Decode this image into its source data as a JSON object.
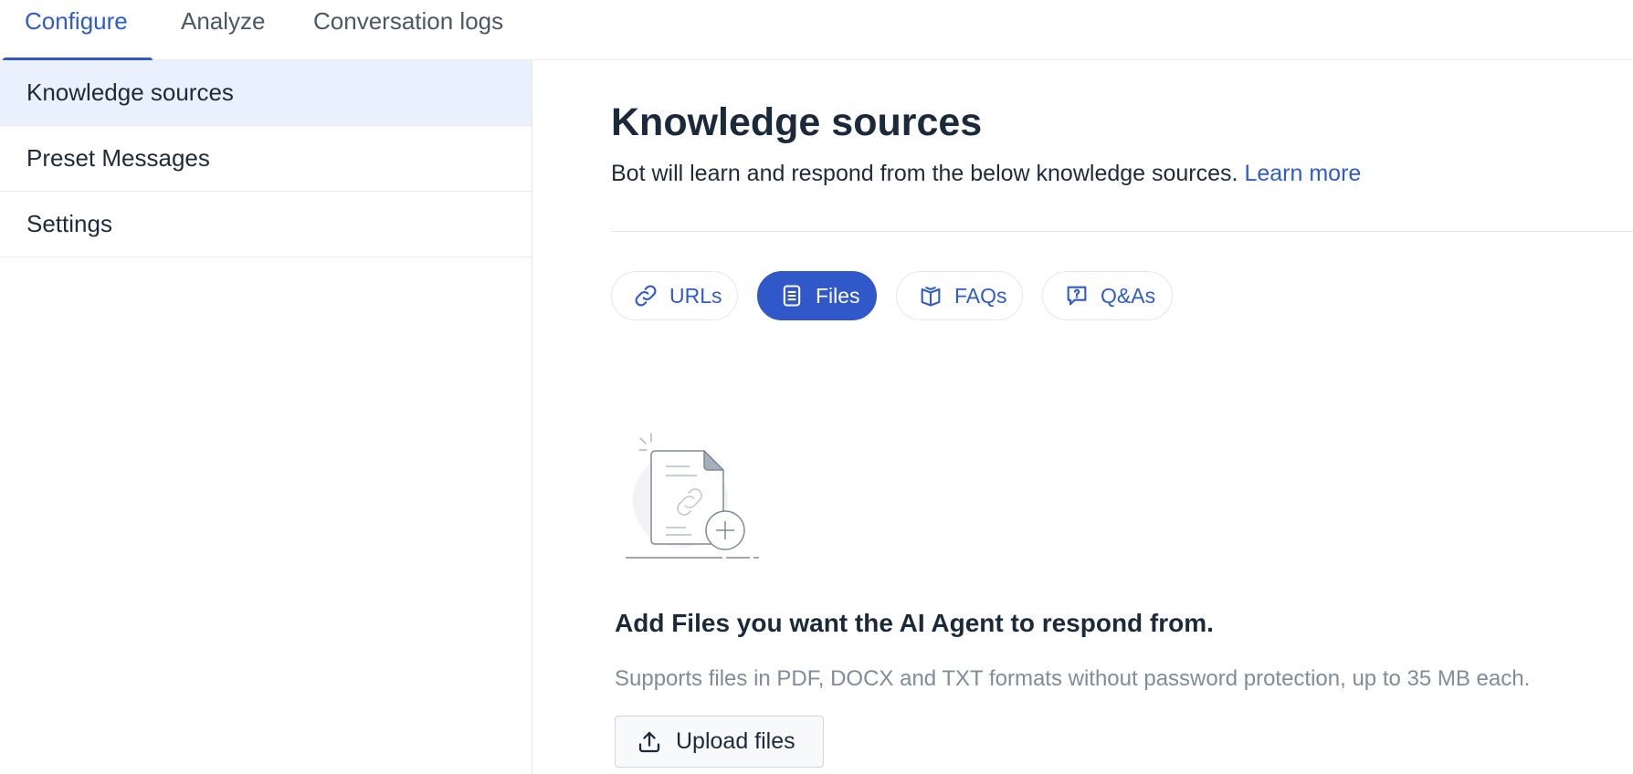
{
  "tabs": [
    {
      "label": "Configure",
      "active": true
    },
    {
      "label": "Analyze",
      "active": false
    },
    {
      "label": "Conversation logs",
      "active": false
    }
  ],
  "sidebar": {
    "items": [
      {
        "label": "Knowledge sources",
        "active": true
      },
      {
        "label": "Preset Messages",
        "active": false
      },
      {
        "label": "Settings",
        "active": false
      }
    ]
  },
  "main": {
    "title": "Knowledge sources",
    "subtitle": "Bot will learn and respond from the below knowledge sources.",
    "learn_more": "Learn more",
    "source_tabs": [
      {
        "label": "URLs",
        "icon": "link-icon",
        "active": false
      },
      {
        "label": "Files",
        "icon": "file-icon",
        "active": true
      },
      {
        "label": "FAQs",
        "icon": "book-icon",
        "active": false
      },
      {
        "label": "Q&As",
        "icon": "chat-question-icon",
        "active": false
      }
    ],
    "empty_state": {
      "illustration": "add-file-illustration",
      "heading": "Add Files you want the AI Agent to respond from.",
      "description": "Supports files in PDF, DOCX and TXT formats without password protection, up to 35 MB each.",
      "upload_label": "Upload files",
      "upload_icon": "upload-icon"
    }
  },
  "colors": {
    "accent": "#3158c8",
    "link": "#2f5cc7",
    "sidebar_active_bg": "#e8f1fd",
    "muted_text": "#7f8c99",
    "heading_text": "#1b2a3b"
  }
}
